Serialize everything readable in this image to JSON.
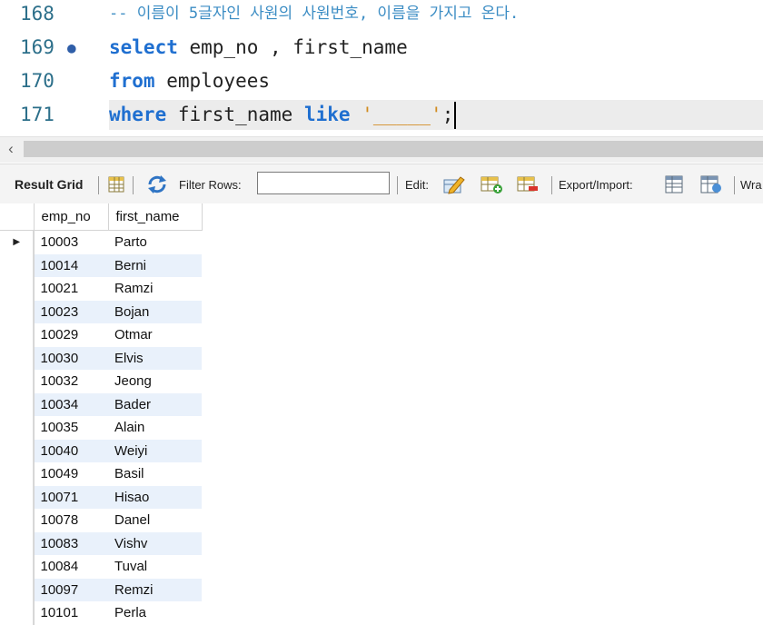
{
  "editor": {
    "lines": [
      {
        "num": "168",
        "comment": "-- 이름이 5글자인 사원의 사원번호, 이름을 가지고 온다."
      },
      {
        "num": "169",
        "kw1": "select",
        "text1": " emp_no , first_name"
      },
      {
        "num": "170",
        "kw1": "from",
        "text1": " employees"
      },
      {
        "num": "171",
        "kw1": "where",
        "text1": " first_name ",
        "kw2": "like",
        "text2": " ",
        "str": "'_____'",
        "end": ";"
      }
    ]
  },
  "toolbar": {
    "result_grid": "Result Grid",
    "filter_rows": "Filter Rows:",
    "filter_value": "",
    "edit": "Edit:",
    "export_import": "Export/Import:",
    "wrap": "Wra"
  },
  "grid": {
    "columns": [
      "emp_no",
      "first_name"
    ],
    "rows": [
      {
        "emp_no": "10003",
        "first_name": "Parto"
      },
      {
        "emp_no": "10014",
        "first_name": "Berni"
      },
      {
        "emp_no": "10021",
        "first_name": "Ramzi"
      },
      {
        "emp_no": "10023",
        "first_name": "Bojan"
      },
      {
        "emp_no": "10029",
        "first_name": "Otmar"
      },
      {
        "emp_no": "10030",
        "first_name": "Elvis"
      },
      {
        "emp_no": "10032",
        "first_name": "Jeong"
      },
      {
        "emp_no": "10034",
        "first_name": "Bader"
      },
      {
        "emp_no": "10035",
        "first_name": "Alain"
      },
      {
        "emp_no": "10040",
        "first_name": "Weiyi"
      },
      {
        "emp_no": "10049",
        "first_name": "Basil"
      },
      {
        "emp_no": "10071",
        "first_name": "Hisao"
      },
      {
        "emp_no": "10078",
        "first_name": "Danel"
      },
      {
        "emp_no": "10083",
        "first_name": "Vishv"
      },
      {
        "emp_no": "10084",
        "first_name": "Tuval"
      },
      {
        "emp_no": "10097",
        "first_name": "Remzi"
      },
      {
        "emp_no": "10101",
        "first_name": "Perla"
      }
    ]
  },
  "colors": {
    "keyword": "#1f6fd0",
    "comment": "#3c8dc4",
    "string": "#d18a1d",
    "row_alt": "#e9f1fb"
  }
}
